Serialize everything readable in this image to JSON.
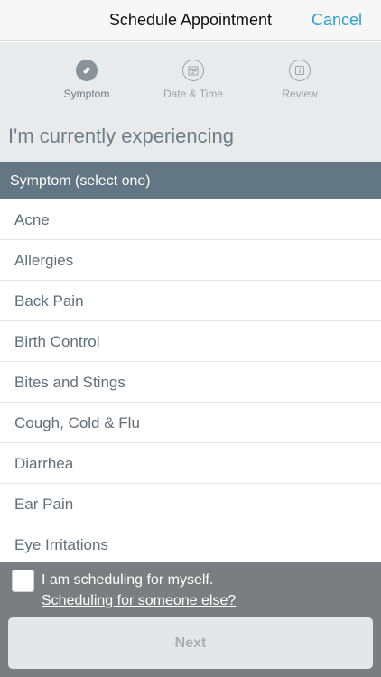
{
  "nav": {
    "title": "Schedule Appointment",
    "cancel_label": "Cancel"
  },
  "steps": [
    {
      "label": "Symptom",
      "icon": "bandage-icon",
      "active": true
    },
    {
      "label": "Date & Time",
      "icon": "calendar-icon",
      "active": false
    },
    {
      "label": "Review",
      "icon": "info-icon",
      "active": false
    }
  ],
  "heading": "I'm currently experiencing",
  "section_header": "Symptom (select one)",
  "symptoms": [
    "Acne",
    "Allergies",
    "Back Pain",
    "Birth Control",
    "Bites and Stings",
    "Cough, Cold & Flu",
    "Diarrhea",
    "Ear Pain",
    "Eye Irritations"
  ],
  "footer": {
    "self_label": "I am scheduling for myself.",
    "else_link": "Scheduling for someone else?",
    "self_checked": false
  },
  "next_label": "Next",
  "colors": {
    "accent": "#2a9fd6",
    "header_bar": "#637684",
    "footer_bg": "#7b7e80"
  }
}
